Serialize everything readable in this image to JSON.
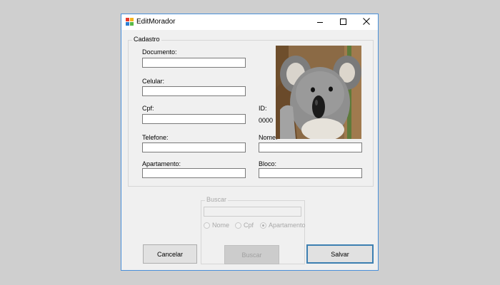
{
  "window": {
    "title": "EditMorador"
  },
  "cadastro": {
    "group_label": "Cadastro",
    "documento_label": "Documento:",
    "documento_value": "",
    "celular_label": "Celular:",
    "celular_value": "",
    "cpf_label": "Cpf:",
    "cpf_value": "",
    "telefone_label": "Telefone:",
    "telefone_value": "",
    "apartamento_label": "Apartamento:",
    "apartamento_value": "",
    "id_label": "ID:",
    "id_value": "0000",
    "nome_label": "Nome:",
    "nome_value": "",
    "bloco_label": "Bloco:",
    "bloco_value": "",
    "photo_icon": "koala-photo"
  },
  "buscar": {
    "group_label": "Buscar",
    "search_value": "",
    "options": [
      {
        "label": "Nome",
        "checked": false
      },
      {
        "label": "Cpf",
        "checked": false
      },
      {
        "label": "Apartamento",
        "checked": true
      }
    ],
    "button_label": "Buscar"
  },
  "buttons": {
    "cancelar": "Cancelar",
    "salvar": "Salvar"
  },
  "colors": {
    "window_border": "#4a90d9",
    "primary_button_border": "#3c7fb1",
    "disabled_text": "#a8a8a8"
  }
}
